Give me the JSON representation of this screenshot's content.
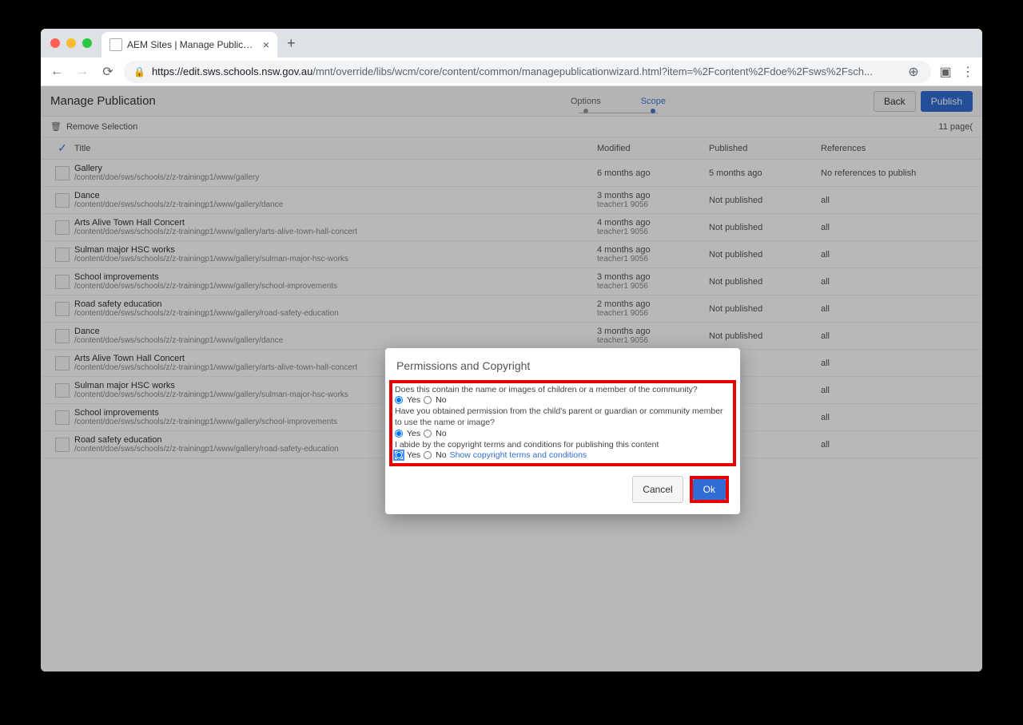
{
  "browser": {
    "tab_title": "AEM Sites | Manage Publicatio",
    "url_host": "https://edit.sws.schools.nsw.gov.au",
    "url_path": "/mnt/override/libs/wcm/core/content/common/managepublicationwizard.html?item=%2Fcontent%2Fdoe%2Fsws%2Fsch..."
  },
  "page": {
    "title": "Manage Publication",
    "step1": "Options",
    "step2": "Scope",
    "back": "Back",
    "publish": "Publish",
    "remove_selection": "Remove Selection",
    "page_count": "11 page(",
    "columns": {
      "title": "Title",
      "modified": "Modified",
      "published": "Published",
      "references": "References"
    }
  },
  "rows": [
    {
      "title": "Gallery",
      "path": "/content/doe/sws/schools/z/z-trainingp1/www/gallery",
      "modified": "6 months ago",
      "user": "",
      "published": "5 months ago",
      "references": "No references to publish"
    },
    {
      "title": "Dance",
      "path": "/content/doe/sws/schools/z/z-trainingp1/www/gallery/dance",
      "modified": "3 months ago",
      "user": "teacher1 9056",
      "published": "Not published",
      "references": "all"
    },
    {
      "title": "Arts Alive Town Hall Concert",
      "path": "/content/doe/sws/schools/z/z-trainingp1/www/gallery/arts-alive-town-hall-concert",
      "modified": "4 months ago",
      "user": "teacher1 9056",
      "published": "Not published",
      "references": "all"
    },
    {
      "title": "Sulman major HSC works",
      "path": "/content/doe/sws/schools/z/z-trainingp1/www/gallery/sulman-major-hsc-works",
      "modified": "4 months ago",
      "user": "teacher1 9056",
      "published": "Not published",
      "references": "all"
    },
    {
      "title": "School improvements",
      "path": "/content/doe/sws/schools/z/z-trainingp1/www/gallery/school-improvements",
      "modified": "3 months ago",
      "user": "teacher1 9056",
      "published": "Not published",
      "references": "all"
    },
    {
      "title": "Road safety education",
      "path": "/content/doe/sws/schools/z/z-trainingp1/www/gallery/road-safety-education",
      "modified": "2 months ago",
      "user": "teacher1 9056",
      "published": "Not published",
      "references": "all"
    },
    {
      "title": "Dance",
      "path": "/content/doe/sws/schools/z/z-trainingp1/www/gallery/dance",
      "modified": "3 months ago",
      "user": "teacher1 9056",
      "published": "Not published",
      "references": "all"
    },
    {
      "title": "Arts Alive Town Hall Concert",
      "path": "/content/doe/sws/schools/z/z-trainingp1/www/gallery/arts-alive-town-hall-concert",
      "modified": "",
      "user": "",
      "published": "hed",
      "references": "all"
    },
    {
      "title": "Sulman major HSC works",
      "path": "/content/doe/sws/schools/z/z-trainingp1/www/gallery/sulman-major-hsc-works",
      "modified": "",
      "user": "",
      "published": "hed",
      "references": "all"
    },
    {
      "title": "School improvements",
      "path": "/content/doe/sws/schools/z/z-trainingp1/www/gallery/school-improvements",
      "modified": "",
      "user": "",
      "published": "hed",
      "references": "all"
    },
    {
      "title": "Road safety education",
      "path": "/content/doe/sws/schools/z/z-trainingp1/www/gallery/road-safety-education",
      "modified": "",
      "user": "",
      "published": "hed",
      "references": "all"
    }
  ],
  "dialog": {
    "title": "Permissions and Copyright",
    "q1": "Does this contain the name or images of children or a member of the community?",
    "q2": "Have you obtained permission from the child's parent or guardian or community member to use the name or image?",
    "q3": "I abide by the copyright terms and conditions for publishing this content",
    "yes": "Yes",
    "no": "No",
    "link": "Show copyright terms and conditions",
    "cancel": "Cancel",
    "ok": "Ok"
  }
}
